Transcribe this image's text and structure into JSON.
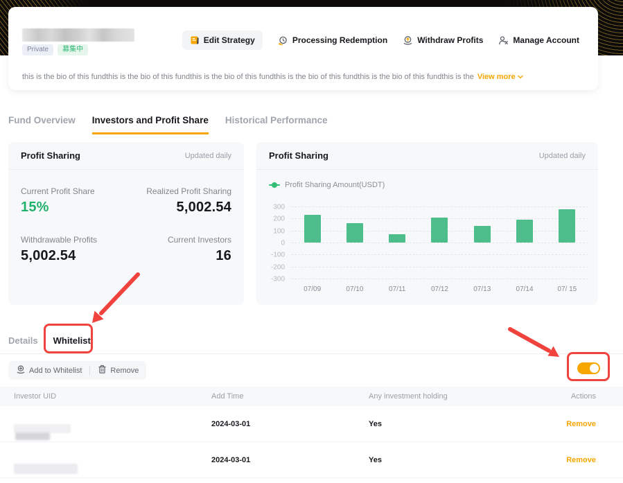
{
  "colors": {
    "accent_orange": "#f7a600",
    "positive_green": "#20b26c",
    "bar_green": "#4dbd8b",
    "annotation_red": "#f0433d",
    "banner_black": "#0d0c0a"
  },
  "header": {
    "badges": [
      {
        "label": "Private"
      },
      {
        "label": "募集中"
      }
    ],
    "actions": [
      {
        "label": "Edit Strategy",
        "icon": "edit-document-icon"
      },
      {
        "label": "Processing Redemption",
        "icon": "redemption-icon"
      },
      {
        "label": "Withdraw Profits",
        "icon": "withdraw-icon"
      },
      {
        "label": "Manage Account",
        "icon": "account-icon"
      }
    ],
    "bio": "this is the bio of this fundthis is the bio of this fundthis is the bio of this fundthis is the bio of this fundthis is the bio of this fundthis is the",
    "view_more": "View more"
  },
  "tabs": [
    {
      "label": "Fund Overview",
      "active": false
    },
    {
      "label": "Investors and Profit Share",
      "active": true
    },
    {
      "label": "Historical Performance",
      "active": false
    }
  ],
  "summary": {
    "title": "Profit Sharing",
    "updated": "Updated daily",
    "stats": [
      {
        "label": "Current Profit Share",
        "value": "15%",
        "color": "#20b26c",
        "align": "left"
      },
      {
        "label": "Realized Profit Sharing",
        "value": "5,002.54",
        "align": "right"
      },
      {
        "label": "Withdrawable Profits",
        "value": "5,002.54",
        "align": "left"
      },
      {
        "label": "Current Investors",
        "value": "16",
        "align": "right"
      }
    ]
  },
  "chart_card": {
    "title": "Profit Sharing",
    "updated": "Updated daily",
    "legend": "Profit Sharing Amount(USDT)"
  },
  "chart_data": {
    "type": "bar",
    "title": "Profit Sharing",
    "x": [
      "07/09",
      "07/10",
      "07/11",
      "07/12",
      "07/13",
      "07/14",
      "07/ 15"
    ],
    "values": [
      230,
      160,
      70,
      210,
      140,
      190,
      275
    ],
    "series_name": "Profit Sharing Amount(USDT)",
    "yticks": [
      300,
      200,
      100,
      0,
      -100,
      -200,
      -300
    ],
    "ylim": [
      -300,
      300
    ],
    "grid": "dashed",
    "legend_position": "top-left",
    "bar_color": "#4dbd8b"
  },
  "whitelist": {
    "tabs": [
      {
        "label": "Details",
        "active": false
      },
      {
        "label": "Whitelist",
        "active": true
      }
    ],
    "toolbar": [
      {
        "label": "Add to Whitelist",
        "icon": "add-to-whitelist-icon"
      },
      {
        "label": "Remove",
        "icon": "trash-icon"
      }
    ],
    "toggle_on": true,
    "table": {
      "columns": [
        "Investor UID",
        "Add Time",
        "Any investment holding",
        "Actions"
      ],
      "rows": [
        {
          "uid": "",
          "add_time": "2024-03-01",
          "holding": "Yes",
          "action": "Remove"
        },
        {
          "uid": "",
          "add_time": "2024-03-01",
          "holding": "Yes",
          "action": "Remove"
        }
      ]
    }
  }
}
